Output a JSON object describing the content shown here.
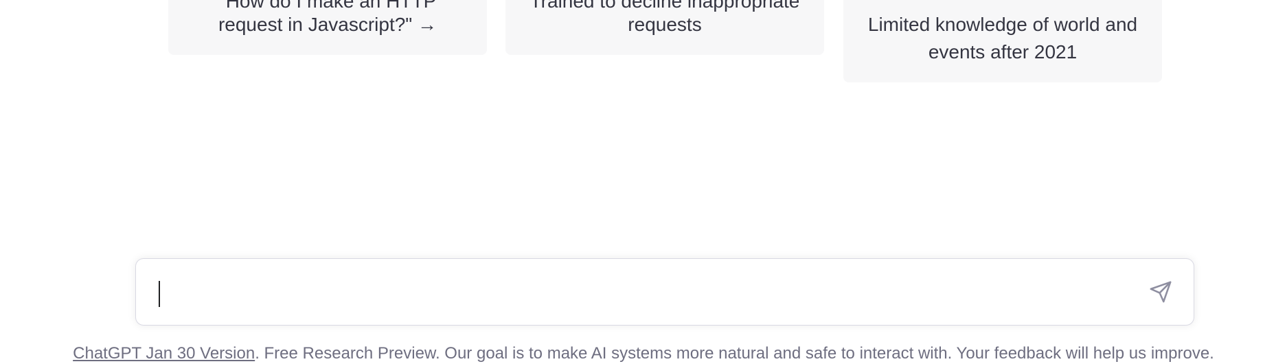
{
  "cards": [
    {
      "line1": "\"How do I make an HTTP",
      "line2": "request in Javascript?\" →"
    },
    {
      "line1": "Trained to decline inappropriate",
      "line2": "requests"
    },
    {
      "line1": "Limited knowledge of world and",
      "line2": "events after 2021"
    }
  ],
  "composer": {
    "value": "",
    "placeholder": "",
    "send_icon": "paper-plane-icon"
  },
  "footer": {
    "version_link": "ChatGPT Jan 30 Version",
    "text": ". Free Research Preview. Our goal is to make AI systems more natural and safe to interact with. Your feedback will help us improve."
  },
  "colors": {
    "card_background": "#f7f7f8",
    "text": "#343541",
    "footer_text": "#6e6e80",
    "border": "#d9d9e3"
  }
}
